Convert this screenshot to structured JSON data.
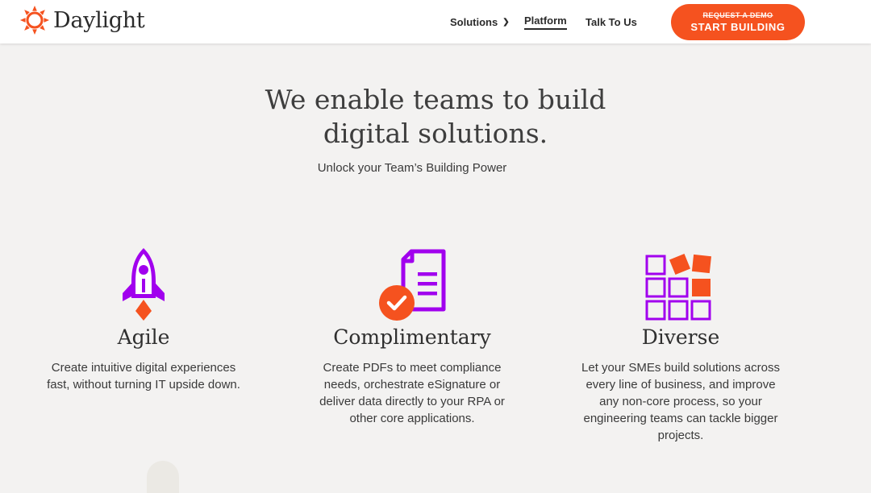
{
  "brand": {
    "name": "Daylight",
    "logo_icon": "sun-icon",
    "accent": "#f5521f"
  },
  "nav": {
    "solutions": "Solutions",
    "platform": "Platform",
    "talk": "Talk To Us",
    "cta_strike": "REQUEST A DEMO",
    "cta_main": "START BUILDING"
  },
  "hero": {
    "title_line1": "We enable teams to build",
    "title_line2": "digital solutions.",
    "subtitle": "Unlock your Team’s Building Power"
  },
  "features": [
    {
      "icon": "rocket-icon",
      "title": "Agile",
      "lines": [
        "Create intuitive digital experiences",
        "fast, without turning IT upside down."
      ]
    },
    {
      "icon": "document-check-icon",
      "title": "Complimentary",
      "lines": [
        "Create PDFs to meet compliance",
        "needs, orchestrate eSignature or",
        "deliver data directly to your RPA or",
        "other core applications."
      ]
    },
    {
      "icon": "blocks-grid-icon",
      "title": "Diverse",
      "lines": [
        "Let your SMEs build solutions across",
        "every line of business, and improve",
        "any non-core process, so your",
        "engineering teams can tackle bigger",
        "projects."
      ]
    }
  ],
  "colors": {
    "purple": "#a100ee",
    "orange": "#f5521f"
  }
}
